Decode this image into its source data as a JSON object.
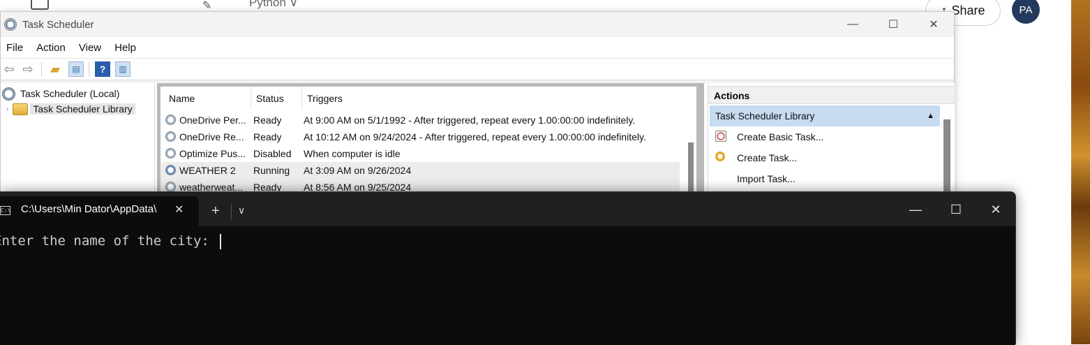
{
  "background": {
    "python_label": "Python ∨",
    "share_label": "Share",
    "avatar_initials": "PA"
  },
  "task_scheduler": {
    "title": "Task Scheduler",
    "menu": [
      "File",
      "Action",
      "View",
      "Help"
    ],
    "tree": {
      "root": "Task Scheduler (Local)",
      "library": "Task Scheduler Library"
    },
    "columns": [
      "Name",
      "Status",
      "Triggers"
    ],
    "tasks": [
      {
        "name": "OneDrive Per...",
        "status": "Ready",
        "trigger": "At 9:00 AM on 5/1/1992 - After triggered, repeat every 1.00:00:00 indefinitely."
      },
      {
        "name": "OneDrive Re...",
        "status": "Ready",
        "trigger": "At 10:12 AM on 9/24/2024 - After triggered, repeat every 1.00:00:00 indefinitely."
      },
      {
        "name": "Optimize Pus...",
        "status": "Disabled",
        "trigger": "When computer is idle"
      },
      {
        "name": "WEATHER 2",
        "status": "Running",
        "trigger": "At 3:09 AM on 9/26/2024"
      },
      {
        "name": "weatherweat...",
        "status": "Ready",
        "trigger": "At 8:56 AM on 9/25/2024"
      }
    ],
    "actions": {
      "header": "Actions",
      "group": "Task Scheduler Library",
      "items": [
        "Create Basic Task...",
        "Create Task...",
        "Import Task..."
      ]
    }
  },
  "terminal": {
    "tab_title": "C:\\Users\\Min Dator\\AppData\\",
    "prompt_text": "Enter the name of the city: ",
    "new_tab_label": "+",
    "dropdown_label": "∨"
  }
}
